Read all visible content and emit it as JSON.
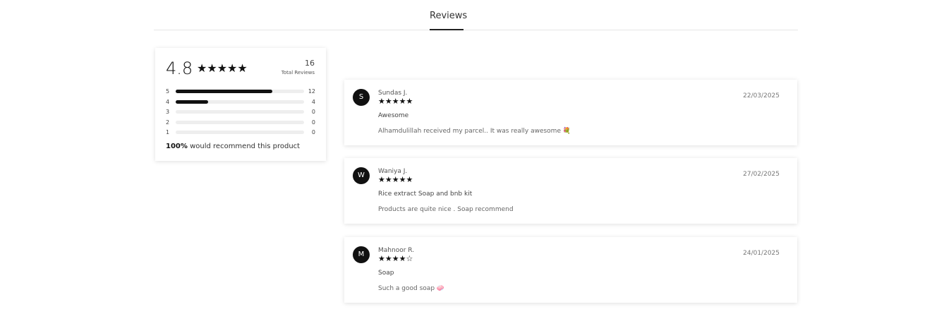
{
  "tabs": {
    "reviews_label": "Reviews"
  },
  "summary": {
    "average": "4.8",
    "stars": "★★★★★",
    "total_count": "16",
    "total_label": "Total Reviews",
    "breakdown": [
      {
        "star": "5",
        "count": "12",
        "fraction": 0.75
      },
      {
        "star": "4",
        "count": "4",
        "fraction": 0.25
      },
      {
        "star": "3",
        "count": "0",
        "fraction": 0
      },
      {
        "star": "2",
        "count": "0",
        "fraction": 0
      },
      {
        "star": "1",
        "count": "0",
        "fraction": 0
      }
    ],
    "recommend_percent": "100%",
    "recommend_text": "would recommend this product"
  },
  "reviews": [
    {
      "initial": "S",
      "name": "Sundas J.",
      "stars": "★★★★★",
      "date": "22/03/2025",
      "title": "Awesome",
      "body": "Alhamdulillah received my parcel.. It was really awesome 💐"
    },
    {
      "initial": "W",
      "name": "Waniya J.",
      "stars": "★★★★★",
      "date": "27/02/2025",
      "title": "Rice extract Soap and bnb kit",
      "body": "Products are quite nice . Soap recommend"
    },
    {
      "initial": "M",
      "name": "Mahnoor R.",
      "stars": "★★★★☆",
      "date": "24/01/2025",
      "title": "Soap",
      "body": "Such a good soap 🧼"
    }
  ]
}
